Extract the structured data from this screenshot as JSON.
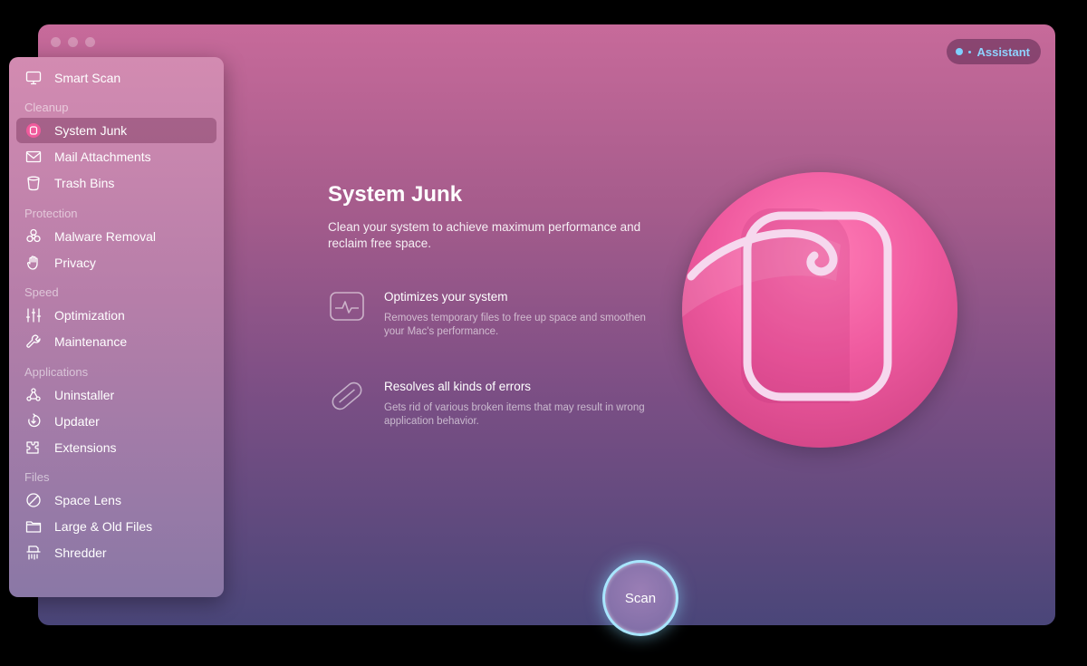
{
  "assistant": {
    "label": "Assistant"
  },
  "sidebar": {
    "smart_scan": "Smart Scan",
    "sections": [
      {
        "header": "Cleanup",
        "items": [
          "System Junk",
          "Mail Attachments",
          "Trash Bins"
        ]
      },
      {
        "header": "Protection",
        "items": [
          "Malware Removal",
          "Privacy"
        ]
      },
      {
        "header": "Speed",
        "items": [
          "Optimization",
          "Maintenance"
        ]
      },
      {
        "header": "Applications",
        "items": [
          "Uninstaller",
          "Updater",
          "Extensions"
        ]
      },
      {
        "header": "Files",
        "items": [
          "Space Lens",
          "Large & Old Files",
          "Shredder"
        ]
      }
    ],
    "active": "System Junk"
  },
  "main": {
    "title": "System Junk",
    "description": "Clean your system to achieve maximum performance and reclaim free space.",
    "features": [
      {
        "title": "Optimizes your system",
        "description": "Removes temporary files to free up space and smoothen your Mac's performance.",
        "icon": "waveform-icon"
      },
      {
        "title": "Resolves all kinds of errors",
        "description": "Gets rid of various broken items that may result in wrong application behavior.",
        "icon": "pill-icon"
      }
    ]
  },
  "scan_button": {
    "label": "Scan"
  },
  "colors": {
    "accent": "#8fd3ff",
    "orb": "#ef5a9f",
    "scan_ring": "#a8e6ff"
  }
}
